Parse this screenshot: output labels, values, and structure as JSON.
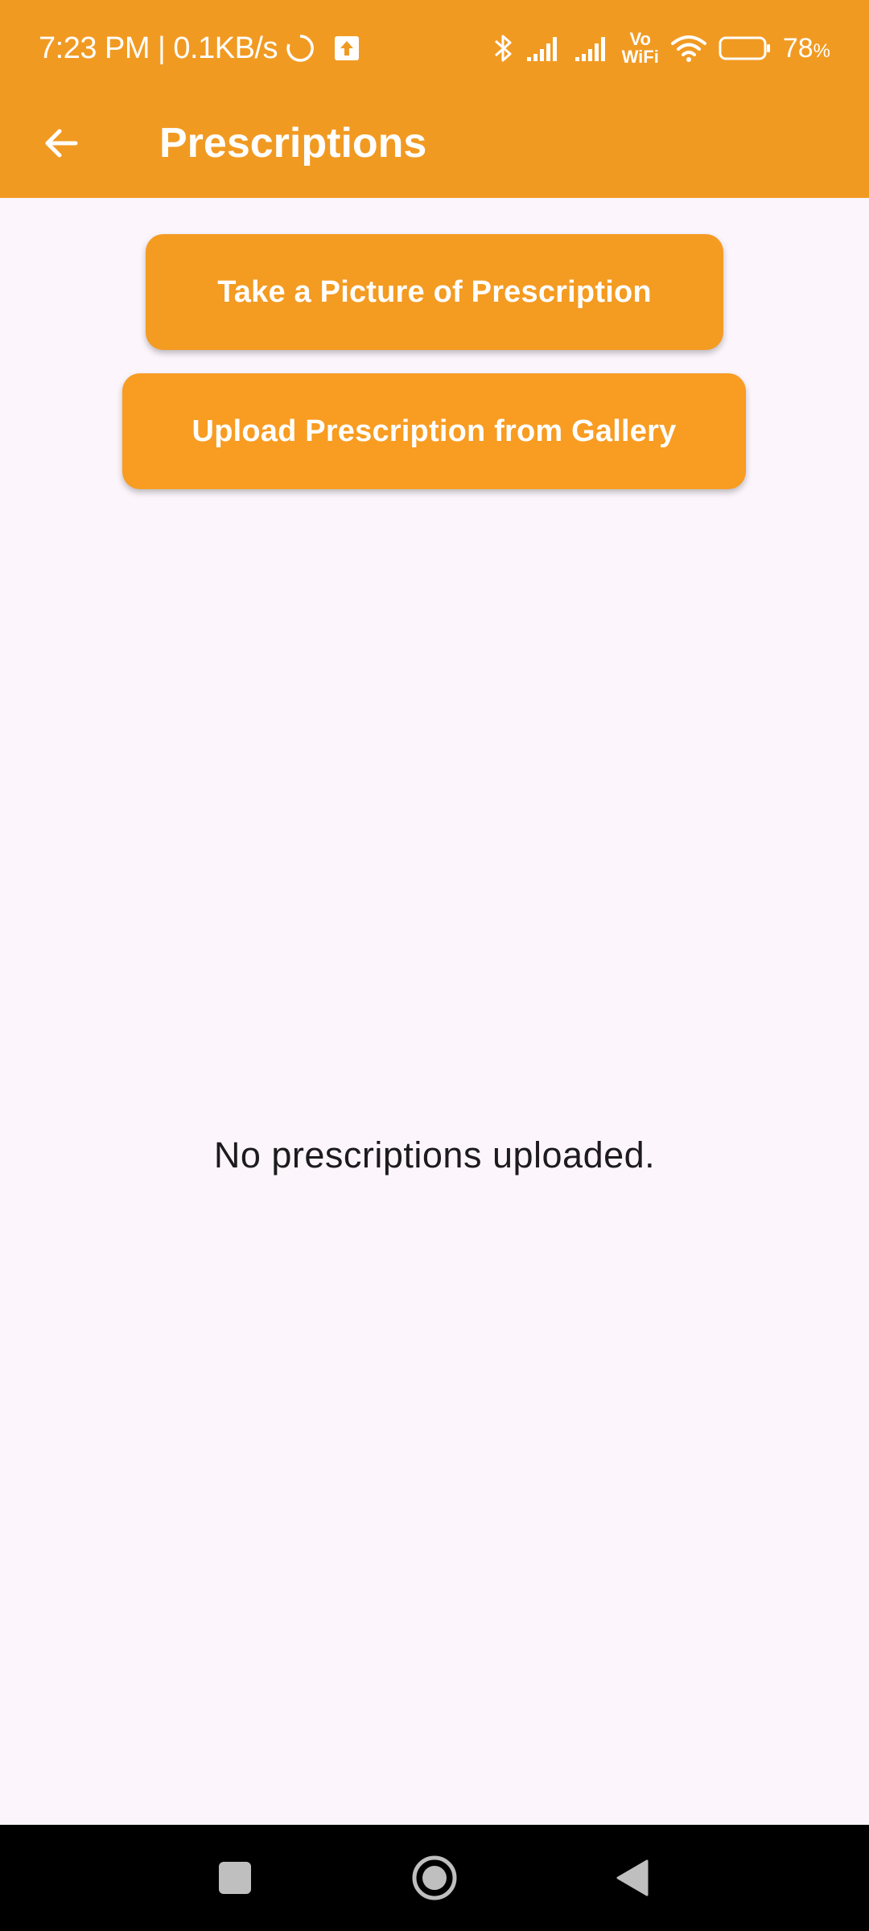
{
  "status_bar": {
    "time": "7:23 PM",
    "separator": "|",
    "network_speed": "0.1KB/s",
    "vowifi_top": "Vo",
    "vowifi_bottom": "WiFi",
    "battery_percent": "78",
    "battery_unit": "%",
    "icons": [
      "loading-circle-icon",
      "upload-notification-icon",
      "bluetooth-icon",
      "signal-icon",
      "signal-icon",
      "wifi-icon",
      "battery-icon"
    ]
  },
  "app_bar": {
    "title": "Prescriptions",
    "back_icon": "arrow-left-icon"
  },
  "actions": {
    "take_picture_label": "Take a Picture of Prescription",
    "upload_gallery_label": "Upload Prescription from Gallery"
  },
  "main": {
    "empty_message": "No prescriptions uploaded."
  },
  "nav_bar": {
    "icons": [
      "recents-square-icon",
      "home-circle-icon",
      "back-triangle-icon"
    ]
  },
  "colors": {
    "primary": "#f19a22",
    "button": "#f49b22",
    "background": "#fcf6fc",
    "text": "#1d1b1e",
    "nav_bar": "#000000"
  }
}
